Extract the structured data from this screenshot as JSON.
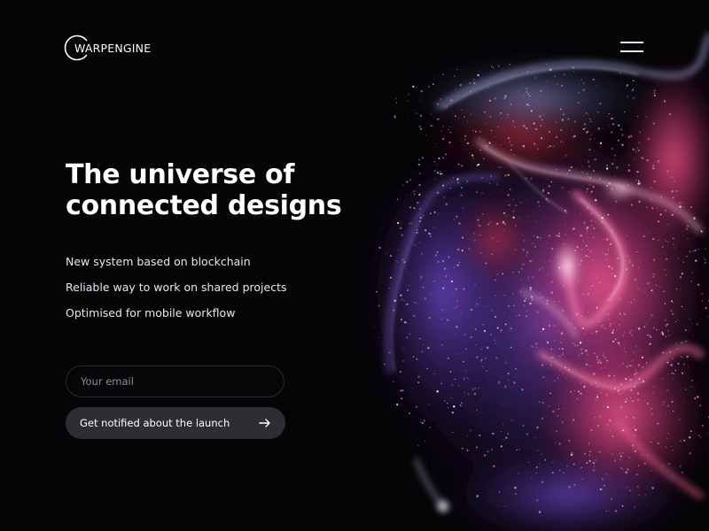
{
  "brand": {
    "name": "WARPENGINE",
    "logo_icon": "arc-logo-icon"
  },
  "header": {
    "menu_icon": "hamburger-menu-icon"
  },
  "hero": {
    "title_line1": "The universe of",
    "title_line2": "connected designs",
    "features": [
      "New system based on blockchain",
      "Reliable way to work on shared projects",
      "Optimised for mobile workflow"
    ]
  },
  "signup": {
    "email_placeholder": "Your email",
    "email_value": "",
    "button_label": "Get notified about the launch",
    "button_icon": "arrow-right-icon"
  },
  "colors": {
    "background": "#050406",
    "button_bg": "#2f2d33",
    "input_border": "#2c2a31",
    "placeholder": "#8f8b96",
    "nebula_pink": "#ff4f8a",
    "nebula_purple": "#8a5cff",
    "nebula_blue": "#9aa6ff"
  }
}
